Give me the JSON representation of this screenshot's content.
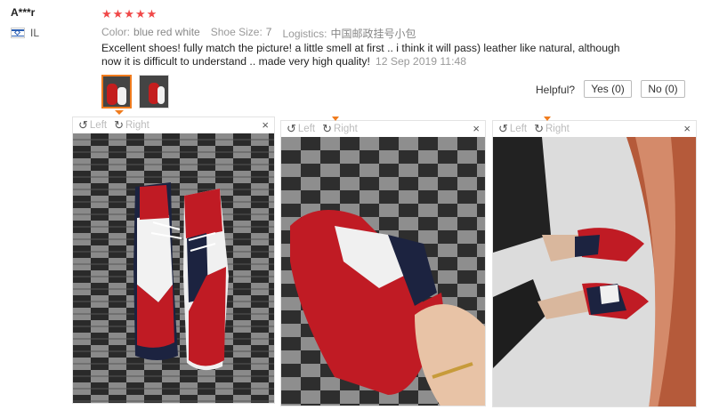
{
  "review": {
    "user": "A***r",
    "country": "IL",
    "stars": "★★★★★",
    "rating": 5,
    "attributes": [
      {
        "key": "Color:",
        "value": "blue red white"
      },
      {
        "key": "Shoe Size:",
        "value": "7"
      },
      {
        "key": "Logistics:",
        "value": "中国邮政挂号小包"
      }
    ],
    "text": "Excellent shoes! fully match the picture! a little smell at first .. i think it will pass) leather like natural, although now it is difficult to understand .. made very high quality!",
    "date": "12 Sep 2019 11:48"
  },
  "helpful": {
    "label": "Helpful?",
    "yes": "Yes (0)",
    "no": "No (0)"
  },
  "viewer": {
    "left_label": "Left",
    "right_label": "Right",
    "close_glyph": "×",
    "rotate_left_icon": "↺",
    "rotate_right_icon": "↻"
  },
  "colors": {
    "star": "#f04848",
    "accent": "#f07c1e"
  }
}
